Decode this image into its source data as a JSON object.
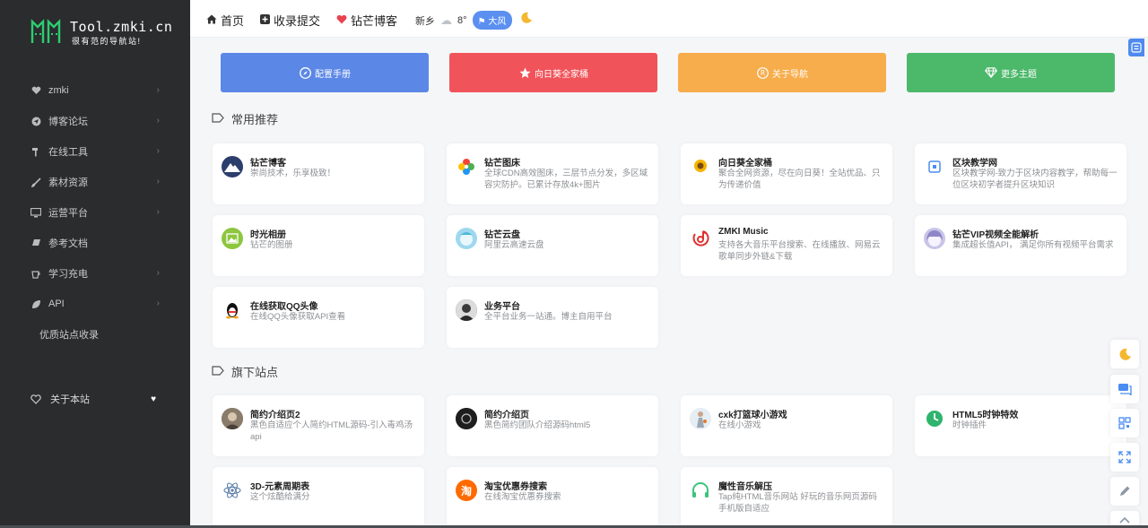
{
  "logo": {
    "title": "Tool.zmki.cn",
    "subtitle": "很有范的导航站!"
  },
  "sidebar": {
    "items": [
      {
        "label": "zmki",
        "icon": "heart-icon"
      },
      {
        "label": "博客论坛",
        "icon": "send-icon"
      },
      {
        "label": "在线工具",
        "icon": "hammer-icon"
      },
      {
        "label": "素材资源",
        "icon": "brush-icon"
      },
      {
        "label": "运营平台",
        "icon": "monitor-icon"
      },
      {
        "label": "参考文档",
        "icon": "book-icon"
      },
      {
        "label": "学习充电",
        "icon": "cup-icon"
      },
      {
        "label": "API",
        "icon": "leaf-icon"
      }
    ],
    "extra_item": "优质站点收录",
    "about": "关于本站"
  },
  "header": {
    "nav": [
      {
        "label": "首页",
        "icon": "home-icon"
      },
      {
        "label": "收录提交",
        "icon": "plus-square-icon"
      },
      {
        "label": "钻芒博客",
        "icon": "heart-icon"
      }
    ],
    "weather": {
      "city": "新乡",
      "temp": "8°",
      "wind": "大风"
    }
  },
  "top_buttons": [
    {
      "label": "配置手册",
      "color": "#5b87e6",
      "icon": "compass-icon"
    },
    {
      "label": "向日葵全家桶",
      "color": "#f0545a",
      "icon": "star-icon"
    },
    {
      "label": "关于导航",
      "color": "#f7ad4b",
      "icon": "registered-icon"
    },
    {
      "label": "更多主题",
      "color": "#4cb86a",
      "icon": "diamond-icon"
    }
  ],
  "sections": [
    {
      "title": "常用推荐",
      "cards": [
        {
          "title": "钻芒博客",
          "desc": "崇尚技术，乐享极致！",
          "icon": "mountain-icon",
          "color": "#2c3e6b"
        },
        {
          "title": "钻芒图床",
          "desc": "全球CDN高效图床，三层节点分发，多区域容灾防护。已累计存放4k+图片",
          "icon": "pinwheel-icon",
          "color": "#ffffff"
        },
        {
          "title": "向日葵全家桶",
          "desc": "聚合全网资源，尽在向日葵！全站优品、只为传递价值",
          "icon": "sunflower-icon",
          "color": "#ffffff"
        },
        {
          "title": "区块教学网",
          "desc": "区块教学网-致力于区块内容教学，帮助每一位区块初学者提升区块知识",
          "icon": "block-icon",
          "color": "#ffffff"
        },
        {
          "title": "时光相册",
          "desc": "钻芒的图册",
          "icon": "photo-icon",
          "color": "#8dc63f"
        },
        {
          "title": "钻芒云盘",
          "desc": "阿里云高速云盘",
          "icon": "anime-avatar-icon",
          "color": "#9fd8ee"
        },
        {
          "title": "ZMKI Music",
          "desc": "支持各大音乐平台搜索、在线播放、网易云歌单同步外链&下载",
          "icon": "music-icon",
          "color": "#ffffff"
        },
        {
          "title": "钻芒VIP视频全能解析",
          "desc": "集成超长值API， 满足你所有视频平台需求",
          "icon": "anime-girl-icon",
          "color": "#c9c5e8"
        },
        {
          "title": "在线获取QQ头像",
          "desc": "在线QQ头像获取API查看",
          "icon": "qq-penguin-icon",
          "color": "#ffffff"
        },
        {
          "title": "业务平台",
          "desc": "全平台业务一站通。博主自用平台",
          "icon": "avatar-icon",
          "color": "#333333"
        }
      ]
    },
    {
      "title": "旗下站点",
      "cards": [
        {
          "title": "简约介绍页2",
          "desc": "黑色自适应个人简约HTML源码-引入毒鸡汤api",
          "icon": "avatar-icon",
          "color": "#6a6a6a"
        },
        {
          "title": "简约介绍页",
          "desc": "黑色简约团队介绍源码html5",
          "icon": "dark-logo-icon",
          "color": "#222222"
        },
        {
          "title": "cxk打篮球小游戏",
          "desc": "在线小游戏",
          "icon": "basketball-player-icon",
          "color": "#dde6ee"
        },
        {
          "title": "HTML5时钟特效",
          "desc": "时钟插件",
          "icon": "clock-icon",
          "color": "#2fb46e"
        },
        {
          "title": "3D-元素周期表",
          "desc": "这个炫酷给满分",
          "icon": "atom-icon",
          "color": "#ffffff"
        },
        {
          "title": "淘宝优惠券搜索",
          "desc": "在线淘宝优惠券搜索",
          "icon": "taobao-icon",
          "color": "#ff6a00"
        },
        {
          "title": "魔性音乐解压",
          "desc": "Tap纯HTML音乐网站 好玩的音乐网页源码 手机版自适应",
          "icon": "headphone-icon",
          "color": "#ffffff"
        }
      ]
    }
  ],
  "float_tools": [
    "moon-icon",
    "chat-icon",
    "qrcode-icon",
    "expand-icon",
    "pencil-icon",
    "arrow-up-icon"
  ]
}
